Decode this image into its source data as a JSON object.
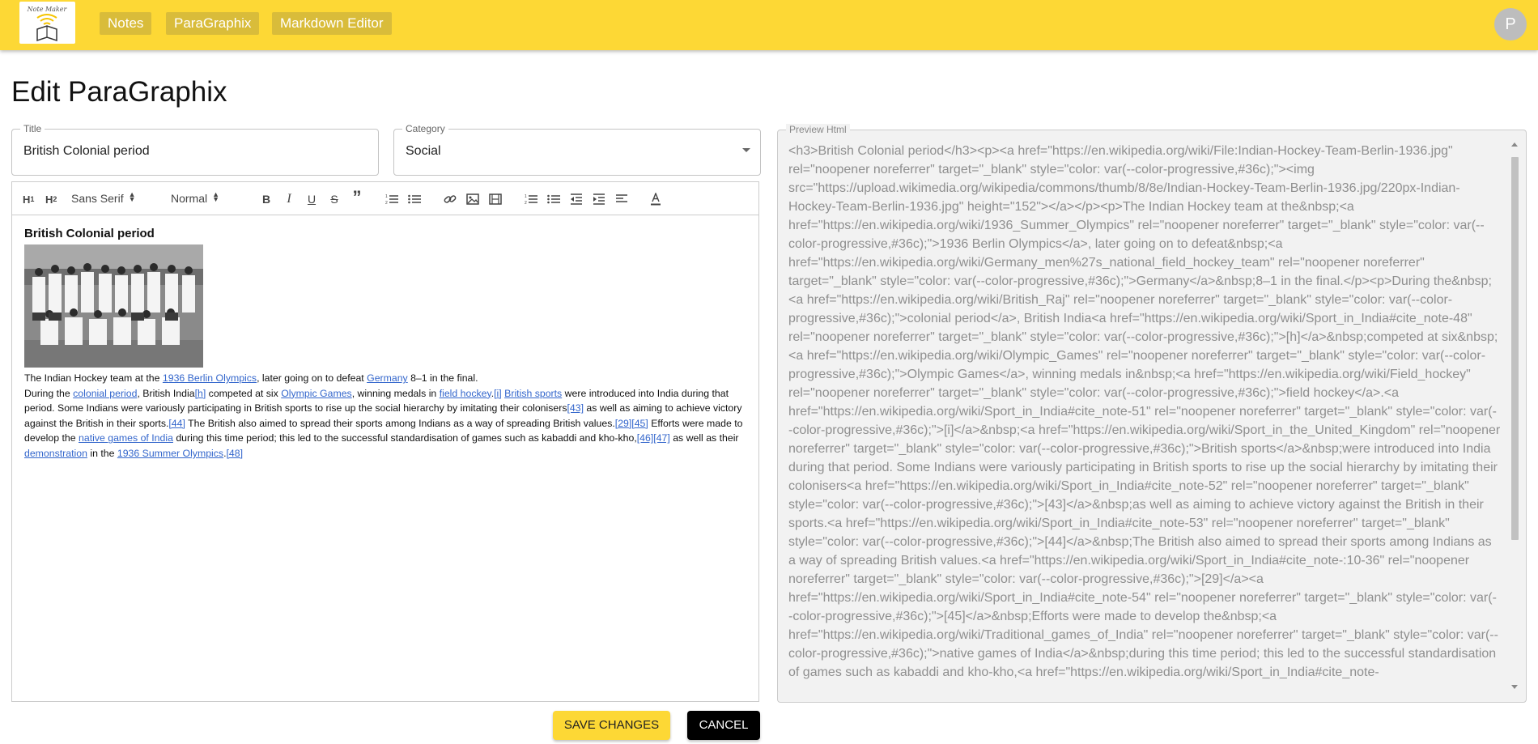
{
  "header": {
    "logo_text": "Note Maker",
    "nav": [
      {
        "label": "Notes"
      },
      {
        "label": "ParaGraphix"
      },
      {
        "label": "Markdown Editor"
      }
    ],
    "avatar_letter": "P"
  },
  "page": {
    "title": "Edit ParaGraphix"
  },
  "form": {
    "title_label": "Title",
    "title_value": "British Colonial period",
    "category_label": "Category",
    "category_value": "Social"
  },
  "toolbar": {
    "h1": "H1",
    "h2": "H2",
    "font": "Sans Serif",
    "size": "Normal",
    "icons": [
      "bold-icon",
      "italic-icon",
      "underline-icon",
      "strike-icon",
      "blockquote-icon",
      "ordered-list-icon",
      "bullet-list-icon",
      "link-icon",
      "image-icon",
      "video-icon",
      "ordered-list-icon",
      "bullet-list-icon",
      "indent-decrease-icon",
      "indent-increase-icon",
      "align-left-icon",
      "text-color-icon"
    ]
  },
  "editor": {
    "heading": "British Colonial period",
    "caption": {
      "t1": "The Indian Hockey team at the ",
      "l1": "1936 Berlin Olympics",
      "t2": ", later going on to defeat ",
      "l2": "Germany",
      "t3": " 8–1 in the final."
    },
    "para": {
      "t1": "During the ",
      "l1": "colonial period",
      "t2": ", British India",
      "l2": "[h]",
      "t3": " competed at six ",
      "l3": "Olympic Games",
      "t4": ", winning medals in ",
      "l4": "field hockey",
      "t5": ".",
      "l5": "[i]",
      "t6": " ",
      "l6": "British sports",
      "t7": " were introduced into India during that period. Some Indians were variously participating in British sports to rise up the social hierarchy by imitating their colonisers",
      "l7": "[43]",
      "t8": " as well as aiming to achieve victory against the British in their sports.",
      "l8": "[44]",
      "t9": " The British also aimed to spread their sports among Indians as a way of spreading British values.",
      "l9": "[29]",
      "l10": "[45]",
      "t10": " Efforts were made to develop the ",
      "l11": "native games of India",
      "t11": " during this time period; this led to the successful standardisation of games such as kabaddi and kho-kho,",
      "l12": "[46]",
      "l13": "[47]",
      "t12": " as well as their ",
      "l14": "demonstration",
      "t13": " in the ",
      "l15": "1936 Summer Olympics",
      "t14": ".",
      "l16": "[48]"
    }
  },
  "preview": {
    "label": "Preview Html",
    "html_text": "<h3>British Colonial period</h3><p><a href=\"https://en.wikipedia.org/wiki/File:Indian-Hockey-Team-Berlin-1936.jpg\" rel=\"noopener noreferrer\" target=\"_blank\" style=\"color: var(--color-progressive,#36c);\"><img src=\"https://upload.wikimedia.org/wikipedia/commons/thumb/8/8e/Indian-Hockey-Team-Berlin-1936.jpg/220px-Indian-Hockey-Team-Berlin-1936.jpg\" height=\"152\"></a></p><p>The Indian Hockey team at the&nbsp;<a href=\"https://en.wikipedia.org/wiki/1936_Summer_Olympics\" rel=\"noopener noreferrer\" target=\"_blank\" style=\"color: var(--color-progressive,#36c);\">1936 Berlin Olympics</a>, later going on to defeat&nbsp;<a href=\"https://en.wikipedia.org/wiki/Germany_men%27s_national_field_hockey_team\" rel=\"noopener noreferrer\" target=\"_blank\" style=\"color: var(--color-progressive,#36c);\">Germany</a>&nbsp;8–1 in the final.</p><p>During the&nbsp;<a href=\"https://en.wikipedia.org/wiki/British_Raj\" rel=\"noopener noreferrer\" target=\"_blank\" style=\"color: var(--color-progressive,#36c);\">colonial period</a>, British India<a href=\"https://en.wikipedia.org/wiki/Sport_in_India#cite_note-48\" rel=\"noopener noreferrer\" target=\"_blank\" style=\"color: var(--color-progressive,#36c);\">[h]</a>&nbsp;competed at six&nbsp;<a href=\"https://en.wikipedia.org/wiki/Olympic_Games\" rel=\"noopener noreferrer\" target=\"_blank\" style=\"color: var(--color-progressive,#36c);\">Olympic Games</a>, winning medals in&nbsp;<a href=\"https://en.wikipedia.org/wiki/Field_hockey\" rel=\"noopener noreferrer\" target=\"_blank\" style=\"color: var(--color-progressive,#36c);\">field hockey</a>.<a href=\"https://en.wikipedia.org/wiki/Sport_in_India#cite_note-51\" rel=\"noopener noreferrer\" target=\"_blank\" style=\"color: var(--color-progressive,#36c);\">[i]</a>&nbsp;<a href=\"https://en.wikipedia.org/wiki/Sport_in_the_United_Kingdom\" rel=\"noopener noreferrer\" target=\"_blank\" style=\"color: var(--color-progressive,#36c);\">British sports</a>&nbsp;were introduced into India during that period. Some Indians were variously participating in British sports to rise up the social hierarchy by imitating their colonisers<a href=\"https://en.wikipedia.org/wiki/Sport_in_India#cite_note-52\" rel=\"noopener noreferrer\" target=\"_blank\" style=\"color: var(--color-progressive,#36c);\">[43]</a>&nbsp;as well as aiming to achieve victory against the British in their sports.<a href=\"https://en.wikipedia.org/wiki/Sport_in_India#cite_note-53\" rel=\"noopener noreferrer\" target=\"_blank\" style=\"color: var(--color-progressive,#36c);\">[44]</a>&nbsp;The British also aimed to spread their sports among Indians as a way of spreading British values.<a href=\"https://en.wikipedia.org/wiki/Sport_in_India#cite_note-:10-36\" rel=\"noopener noreferrer\" target=\"_blank\" style=\"color: var(--color-progressive,#36c);\">[29]</a><a href=\"https://en.wikipedia.org/wiki/Sport_in_India#cite_note-54\" rel=\"noopener noreferrer\" target=\"_blank\" style=\"color: var(--color-progressive,#36c);\">[45]</a>&nbsp;Efforts were made to develop the&nbsp;<a href=\"https://en.wikipedia.org/wiki/Traditional_games_of_India\" rel=\"noopener noreferrer\" target=\"_blank\" style=\"color: var(--color-progressive,#36c);\">native games of India</a>&nbsp;during this time period; this led to the successful standardisation of games such as kabaddi and kho-kho,<a href=\"https://en.wikipedia.org/wiki/Sport_in_India#cite_note-"
  },
  "actions": {
    "save": "Save Changes",
    "cancel": "Cancel"
  },
  "colors": {
    "header": "#fdd835",
    "nav_button": "#d9bc3a",
    "link": "#3366cc",
    "cancel_bg": "#000000"
  }
}
